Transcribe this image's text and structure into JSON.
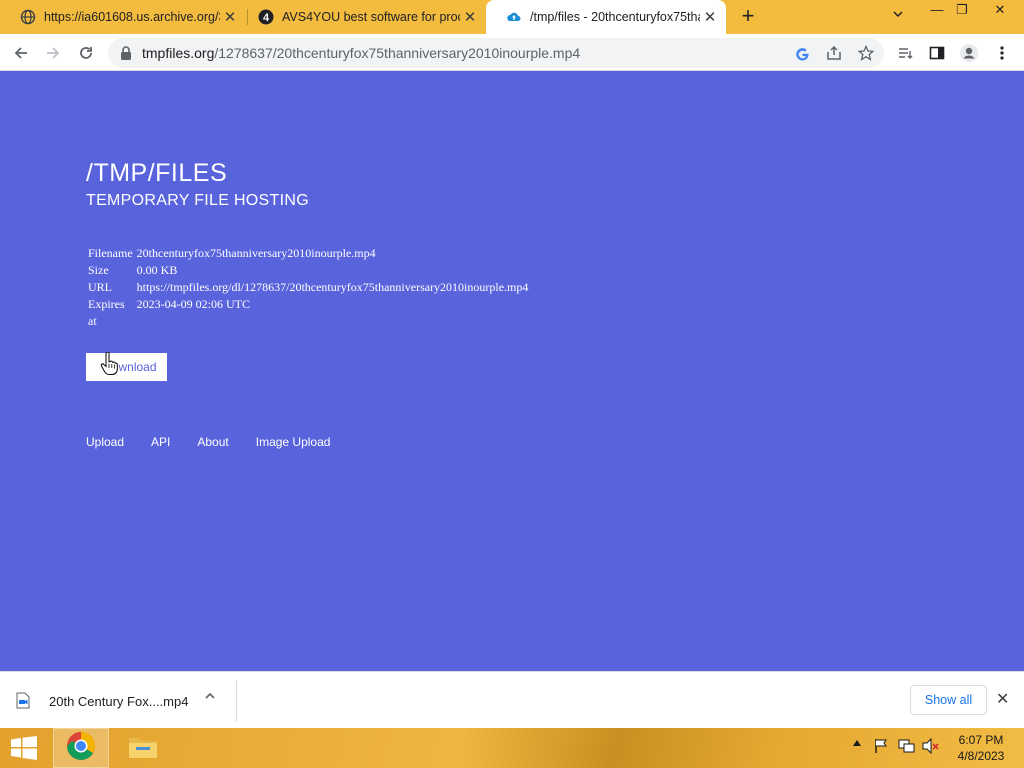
{
  "tabs": [
    {
      "title": "https://ia601608.us.archive.org/3",
      "close": "✕"
    },
    {
      "title": "AVS4YOU best software for proce",
      "close": "✕"
    },
    {
      "title": "/tmp/files - 20thcenturyfox75tha",
      "close": "✕"
    }
  ],
  "new_tab": "+",
  "window": {
    "minimize": "—",
    "restore": "❐",
    "close": "✕"
  },
  "omnibox": {
    "domain": "tmpfiles.org",
    "path": "/1278637/20thcenturyfox75thanniversary2010inourple.mp4"
  },
  "page": {
    "title": "/TMP/FILES",
    "subtitle": "TEMPORARY FILE HOSTING",
    "info": [
      {
        "key": "Filename",
        "value": "20thcenturyfox75thanniversary2010inourple.mp4"
      },
      {
        "key": "Size",
        "value": "0.00 KB"
      },
      {
        "key": "URL",
        "value": "https://tmpfiles.org/dl/1278637/20thcenturyfox75thanniversary2010inourple.mp4"
      },
      {
        "key": "Expires at",
        "value": "2023-04-09 02:06 UTC"
      }
    ],
    "download_button": "wnload",
    "footer_links": [
      "Upload",
      "API",
      "About",
      "Image Upload"
    ]
  },
  "download_shelf": {
    "file_name": "20th Century Fox....mp4",
    "show_all": "Show all",
    "close": "✕"
  },
  "taskbar": {
    "time": "6:07 PM",
    "date": "4/8/2023"
  },
  "colors": {
    "page_bg": "#5863dc",
    "tabstrip_bg": "#f3bc3f",
    "link_blue": "#1a73e8"
  }
}
